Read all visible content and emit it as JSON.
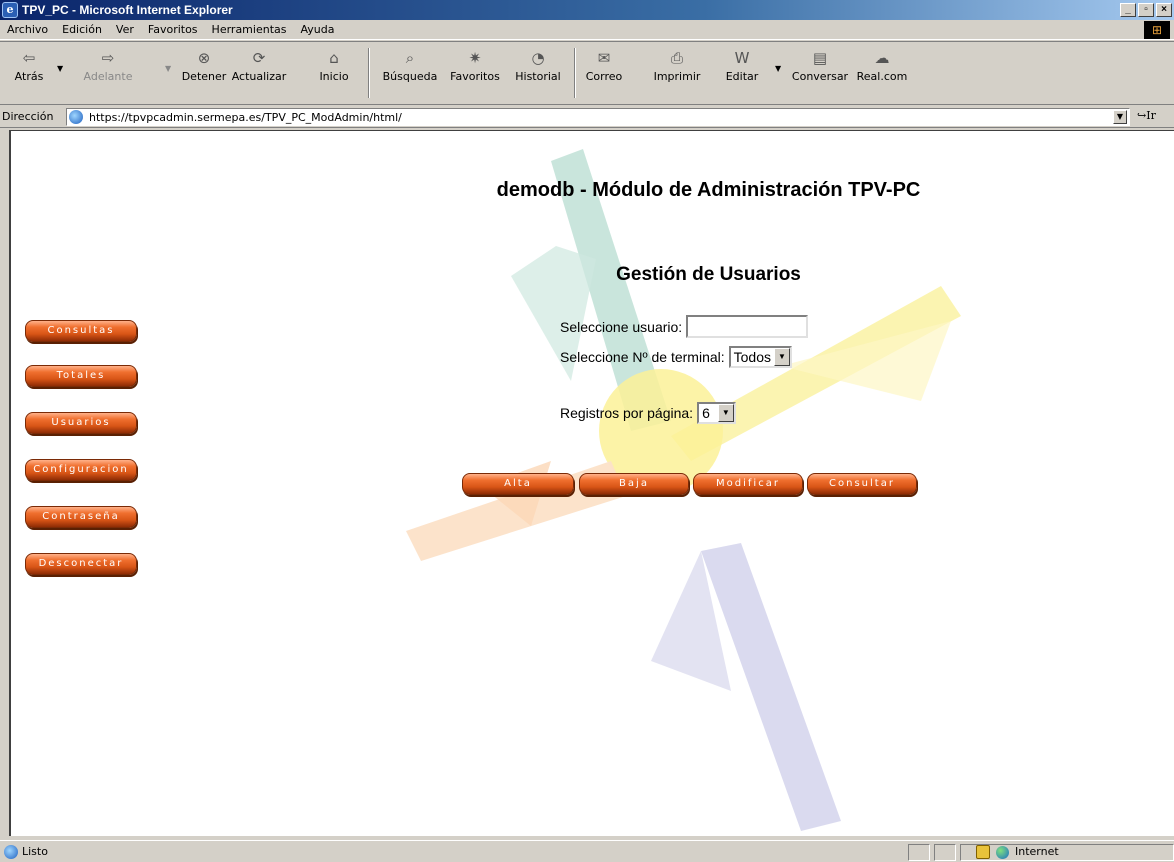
{
  "window": {
    "title": "TPV_PC - Microsoft Internet Explorer"
  },
  "menu": [
    "Archivo",
    "Edición",
    "Ver",
    "Favoritos",
    "Herramientas",
    "Ayuda"
  ],
  "toolbar": {
    "back": "Atrás",
    "forward": "Adelante",
    "stop": "Detener",
    "refresh": "Actualizar",
    "home": "Inicio",
    "search": "Búsqueda",
    "favorites": "Favoritos",
    "history": "Historial",
    "mail": "Correo",
    "print": "Imprimir",
    "edit": "Editar",
    "discuss": "Conversar",
    "realcom": "Real.com"
  },
  "address": {
    "label": "Dirección",
    "url": "https://tpvpcadmin.sermepa.es/TPV_PC_ModAdmin/html/",
    "go": "Ir"
  },
  "page": {
    "title": "demodb - Módulo de Administración TPV-PC",
    "section_title": "Gestión de Usuarios",
    "sidebar": [
      "Consultas",
      "Totales",
      "Usuarios",
      "Configuracion",
      "Contraseña",
      "Desconectar"
    ],
    "form": {
      "user_label": "Seleccione usuario:",
      "user_value": "",
      "terminal_label": "Seleccione Nº de terminal:",
      "terminal_value": "Todos",
      "records_label": "Registros por página:",
      "records_value": "6"
    },
    "actions": {
      "add": "Alta",
      "remove": "Baja",
      "modify": "Modificar",
      "query": "Consultar"
    }
  },
  "status": {
    "text": "Listo",
    "zone": "Internet"
  }
}
